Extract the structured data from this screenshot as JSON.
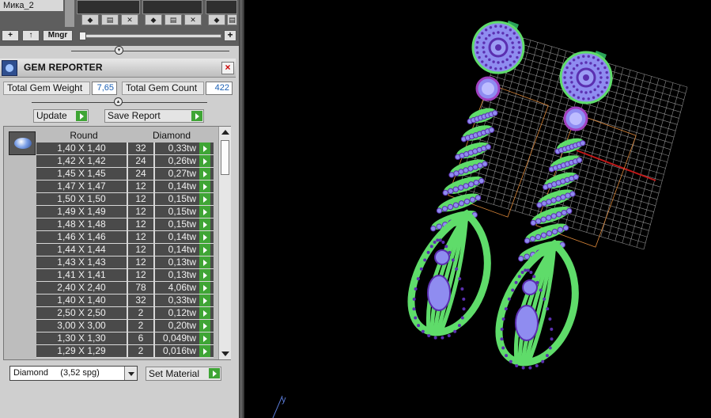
{
  "top_strip": {
    "layer_name": "Мика_2",
    "add_button": "+",
    "up_button": "↑",
    "manager_button": "Mngr",
    "zoom_plus": "+"
  },
  "gem_reporter": {
    "title": "GEM REPORTER",
    "close": "×",
    "total_weight_label": "Total Gem Weight",
    "total_weight_value": "7,65",
    "total_count_label": "Total Gem Count",
    "total_count_value": "422",
    "update_label": "Update",
    "save_report_label": "Save Report",
    "columns": {
      "shape": "Round",
      "material": "Diamond"
    },
    "rows": [
      {
        "size": "1,40 X 1,40",
        "count": "32",
        "weight": "0,33tw"
      },
      {
        "size": "1,42 X 1,42",
        "count": "24",
        "weight": "0,26tw"
      },
      {
        "size": "1,45 X 1,45",
        "count": "24",
        "weight": "0,27tw"
      },
      {
        "size": "1,47 X 1,47",
        "count": "12",
        "weight": "0,14tw"
      },
      {
        "size": "1,50 X 1,50",
        "count": "12",
        "weight": "0,15tw"
      },
      {
        "size": "1,49 X 1,49",
        "count": "12",
        "weight": "0,15tw"
      },
      {
        "size": "1,48 X 1,48",
        "count": "12",
        "weight": "0,15tw"
      },
      {
        "size": "1,46 X 1,46",
        "count": "12",
        "weight": "0,14tw"
      },
      {
        "size": "1,44 X 1,44",
        "count": "12",
        "weight": "0,14tw"
      },
      {
        "size": "1,43 X 1,43",
        "count": "12",
        "weight": "0,13tw"
      },
      {
        "size": "1,41 X 1,41",
        "count": "12",
        "weight": "0,13tw"
      },
      {
        "size": "2,40 X 2,40",
        "count": "78",
        "weight": "4,06tw"
      },
      {
        "size": "1,40 X 1,40",
        "count": "32",
        "weight": "0,33tw"
      },
      {
        "size": "2,50 X 2,50",
        "count": "2",
        "weight": "0,12tw"
      },
      {
        "size": "3,00 X 3,00",
        "count": "2",
        "weight": "0,20tw"
      },
      {
        "size": "1,30 X 1,30",
        "count": "6",
        "weight": "0,049tw"
      },
      {
        "size": "1,29 X 1,29",
        "count": "2",
        "weight": "0,016tw"
      }
    ],
    "material_selected": "Diamond     (3,52 spg)",
    "set_material_label": "Set Material"
  },
  "viewport": {
    "axis_label": "y"
  },
  "colors": {
    "metal": "#5fdc6a",
    "gem": "#8f8cf0",
    "grid": "#bdbdbd",
    "axis_x": "#c01818",
    "bounding_box": "#e08a3a"
  }
}
